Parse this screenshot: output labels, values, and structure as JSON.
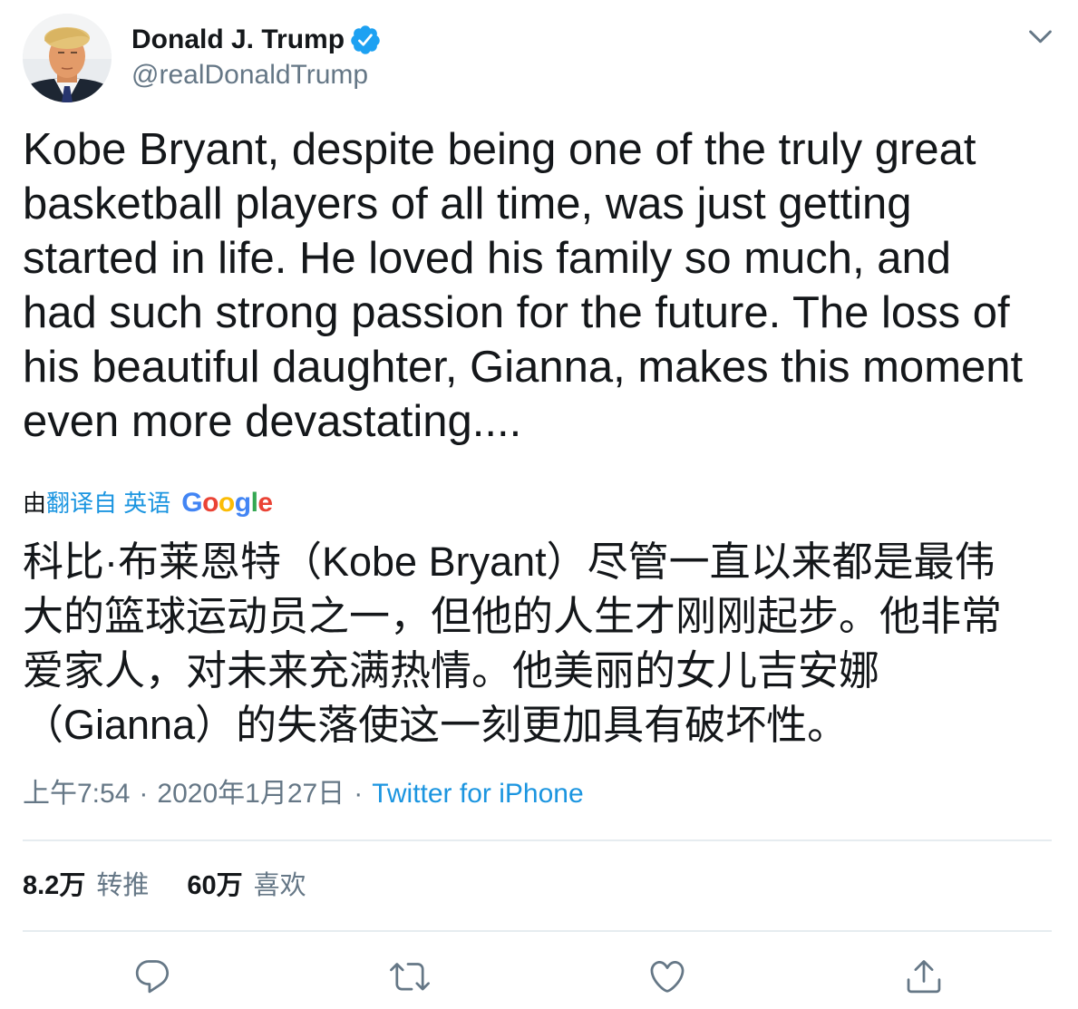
{
  "author": {
    "name": "Donald J. Trump",
    "handle": "@realDonaldTrump",
    "verified": true,
    "avatar_icon": "user-avatar",
    "verified_icon": "verified-badge-icon"
  },
  "header": {
    "more_icon": "chevron-down-icon"
  },
  "tweet": {
    "text_lines": [
      "Kobe Bryant, despite being one of the truly great",
      "basketball players of all time, was just getting",
      "started in life. He loved his family so much, and",
      "had such strong passion for the future. The loss of",
      "his beautiful daughter, Gianna, makes this moment",
      "even more devastating...."
    ]
  },
  "translation": {
    "by_label": "由",
    "translated_from_label": "翻译自 英语",
    "provider": "Google",
    "provider_logo_colors": [
      "#4285f4",
      "#ea4335",
      "#fbbc05",
      "#4285f4",
      "#34a853",
      "#ea4335"
    ],
    "text_lines": [
      "科比·布莱恩特（Kobe Bryant）尽管一直以来都是最伟",
      "大的篮球运动员之一，但他的人生才刚刚起步。他非常",
      "爱家人，对未来充满热情。他美丽的女儿吉安娜",
      "（Gianna）的失落使这一刻更加具有破坏性。"
    ]
  },
  "meta": {
    "time": "上午7:54",
    "separator": "·",
    "date": "2020年1月27日",
    "source": "Twitter for iPhone"
  },
  "stats": {
    "retweets_count": "8.2万",
    "retweets_label": "转推",
    "likes_count": "60万",
    "likes_label": "喜欢"
  },
  "actions": [
    {
      "name": "reply",
      "icon": "reply-icon"
    },
    {
      "name": "retweet",
      "icon": "retweet-icon"
    },
    {
      "name": "like",
      "icon": "heart-icon"
    },
    {
      "name": "share",
      "icon": "share-icon"
    }
  ],
  "colors": {
    "text": "#14171a",
    "secondary": "#657786",
    "link": "#1b95e0",
    "verified": "#1da1f2",
    "divider": "#e6ecf0"
  }
}
